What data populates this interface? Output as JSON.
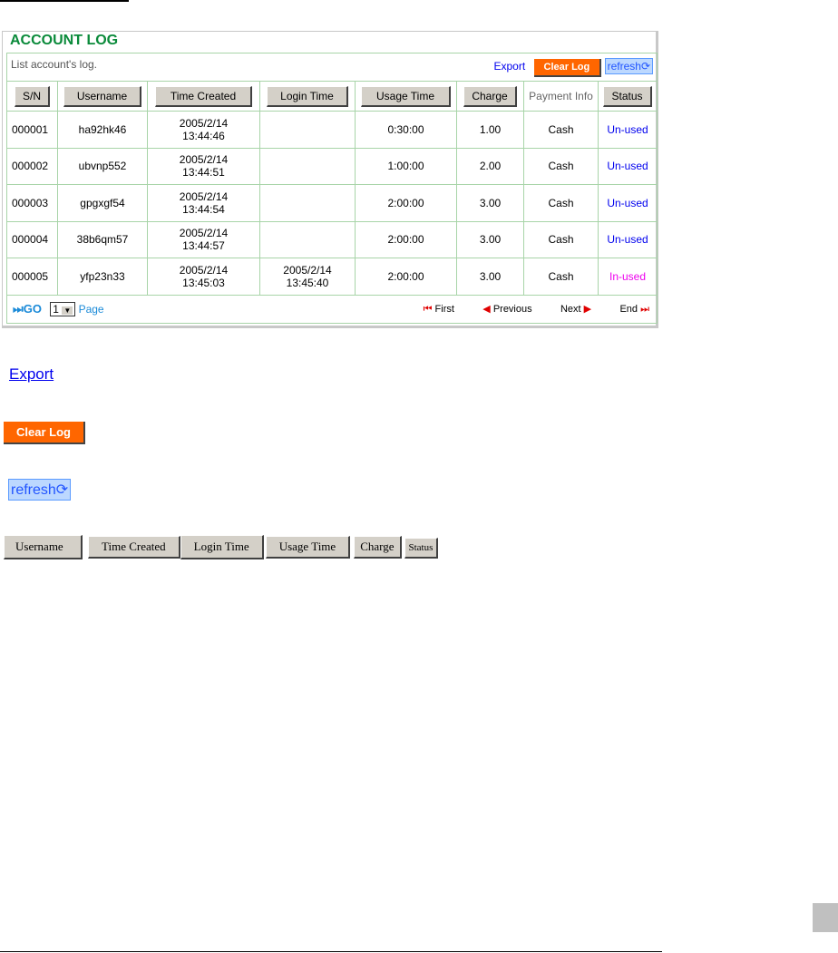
{
  "panel": {
    "title": "ACCOUNT LOG",
    "description": "List account's log.",
    "export": "Export",
    "clear_log": "Clear Log",
    "refresh": "refresh"
  },
  "columns": [
    "S/N",
    "Username",
    "Time Created",
    "Login Time",
    "Usage Time",
    "Charge",
    "Payment Info",
    "Status"
  ],
  "rows": [
    {
      "sn": "000001",
      "username": "ha92hk46",
      "created_date": "2005/2/14",
      "created_time": "13:44:46",
      "login_date": "",
      "login_time": "",
      "usage": "0:30:00",
      "charge": "1.00",
      "payment": "Cash",
      "status": "Un-used"
    },
    {
      "sn": "000002",
      "username": "ubvnp552",
      "created_date": "2005/2/14",
      "created_time": "13:44:51",
      "login_date": "",
      "login_time": "",
      "usage": "1:00:00",
      "charge": "2.00",
      "payment": "Cash",
      "status": "Un-used"
    },
    {
      "sn": "000003",
      "username": "gpgxgf54",
      "created_date": "2005/2/14",
      "created_time": "13:44:54",
      "login_date": "",
      "login_time": "",
      "usage": "2:00:00",
      "charge": "3.00",
      "payment": "Cash",
      "status": "Un-used"
    },
    {
      "sn": "000004",
      "username": "38b6qm57",
      "created_date": "2005/2/14",
      "created_time": "13:44:57",
      "login_date": "",
      "login_time": "",
      "usage": "2:00:00",
      "charge": "3.00",
      "payment": "Cash",
      "status": "Un-used"
    },
    {
      "sn": "000005",
      "username": "yfp23n33",
      "created_date": "2005/2/14",
      "created_time": "13:45:03",
      "login_date": "2005/2/14",
      "login_time": "13:45:40",
      "usage": "2:00:00",
      "charge": "3.00",
      "payment": "Cash",
      "status": "In-used"
    }
  ],
  "pager": {
    "go": "GO",
    "page_value": "1",
    "page_label": "Page",
    "first": "First",
    "previous": "Previous",
    "next": "Next",
    "end": "End"
  },
  "legend": {
    "export": "Export",
    "clear_log": "Clear Log",
    "refresh": "refresh",
    "buttons": [
      "Username",
      "Time Created",
      "Login Time",
      "Usage Time",
      "Charge",
      "Status"
    ]
  },
  "colors": {
    "title": "#0a8a3a",
    "unused": "#0000ee",
    "inused": "#ee00ee",
    "clear": "#ff6600"
  }
}
